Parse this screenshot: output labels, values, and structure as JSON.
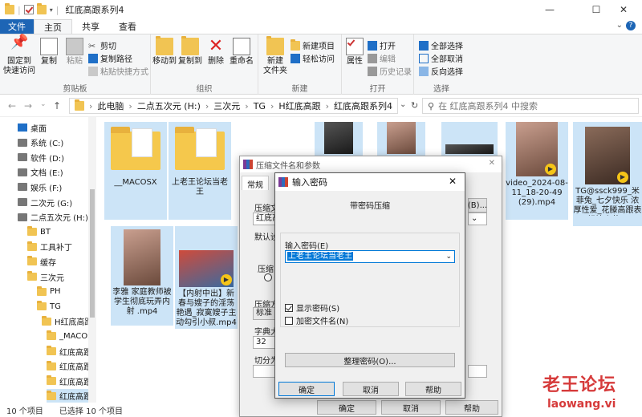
{
  "window": {
    "title": "红底高跟系列4",
    "min": "—",
    "max": "☐",
    "close": "✕"
  },
  "ribbon_tabs": [
    "文件",
    "主页",
    "共享",
    "查看"
  ],
  "ribbon": {
    "clipboard": {
      "pin": "固定到\n快速访问",
      "copy": "复制",
      "paste": "粘贴",
      "cut": "剪切",
      "copy_path": "复制路径",
      "paste_shortcut": "粘贴快捷方式",
      "label": "剪贴板"
    },
    "organize": {
      "move_to": "移动到",
      "copy_to": "复制到",
      "delete": "删除",
      "rename": "重命名",
      "label": "组织"
    },
    "new": {
      "new_folder": "新建\n文件夹",
      "new_item": "新建项目",
      "easy_access": "轻松访问",
      "label": "新建"
    },
    "open": {
      "properties": "属性",
      "open": "打开",
      "edit": "编辑",
      "history": "历史记录",
      "label": "打开"
    },
    "select": {
      "select_all": "全部选择",
      "select_none": "全部取消",
      "invert": "反向选择",
      "label": "选择"
    }
  },
  "address": {
    "breadcrumbs": [
      "此电脑",
      "二点五次元 (H:)",
      "三次元",
      "TG",
      "H红底高跟",
      "红底高跟系列4"
    ],
    "search_placeholder": "在 红底高跟系列4 中搜索"
  },
  "nav": [
    {
      "label": "桌面",
      "icon": "desktop-icon"
    },
    {
      "label": "系统 (C:)",
      "icon": "drive-icon"
    },
    {
      "label": "软件 (D:)",
      "icon": "drive-icon"
    },
    {
      "label": "文档 (E:)",
      "icon": "drive-icon"
    },
    {
      "label": "娱乐 (F:)",
      "icon": "drive-icon"
    },
    {
      "label": "二次元 (G:)",
      "icon": "drive-icon"
    },
    {
      "label": "二点五次元 (H:)",
      "icon": "drive-icon"
    },
    {
      "label": "BT",
      "icon": "folder-icon"
    },
    {
      "label": "工具补丁",
      "icon": "folder-icon"
    },
    {
      "label": "缓存",
      "icon": "folder-icon"
    },
    {
      "label": "三次元",
      "icon": "folder-icon"
    },
    {
      "label": "PH",
      "icon": "folder-icon"
    },
    {
      "label": "TG",
      "icon": "folder-icon"
    },
    {
      "label": "H红底高跟",
      "icon": "folder-icon"
    },
    {
      "label": "_MACOS",
      "icon": "folder-icon"
    },
    {
      "label": "红底高跟系",
      "icon": "folder-icon"
    },
    {
      "label": "红底高跟系",
      "icon": "folder-icon"
    },
    {
      "label": "红底高跟系",
      "icon": "folder-icon"
    },
    {
      "label": "红底高跟系",
      "icon": "folder-icon"
    }
  ],
  "files": [
    {
      "name": "__MACOSX",
      "kind": "folder"
    },
    {
      "name": "上老王论坛当老王",
      "kind": "folder"
    },
    {
      "name": "",
      "kind": "video"
    },
    {
      "name": "",
      "kind": "video"
    },
    {
      "name": "",
      "kind": "video"
    },
    {
      "name": "video_2024-08-11_18-20-49 (29).mp4",
      "kind": "video"
    },
    {
      "name": "TG@ssck999_米菲兔_七夕快乐 浓厚性爱_花滕高跟表姐情人节...",
      "kind": "video"
    },
    {
      "name": "李雅 家庭教师被学生彻底玩弄内射 .mp4",
      "kind": "video"
    },
    {
      "name": "【内射中出】新春与嫂子的淫荡艳遇_寂寞嫂子主动勾引小叔.mp4",
      "kind": "video"
    }
  ],
  "status": {
    "count": "10 个项目",
    "selected": "已选择 10 个项目"
  },
  "archive_dialog": {
    "title": "压缩文件名和参数",
    "tab_general": "常规",
    "label_archive_name": "压缩文",
    "archive_name_value": "红底高",
    "browse": "(B)...",
    "label_default": "默认设",
    "label_format": "压缩",
    "label_method": "压缩方",
    "method_value": "标准",
    "label_dict": "字典大",
    "dict_value": "32",
    "label_split": "切分为",
    "ok": "确定",
    "cancel": "取消",
    "help": "帮助"
  },
  "password_dialog": {
    "title": "输入密码",
    "heading": "带密码压缩",
    "label_password": "输入密码(E)",
    "password_value": "上老王论坛当老王",
    "show_password": "显示密码(S)",
    "encrypt_names": "加密文件名(N)",
    "organize": "整理密码(O)...",
    "ok": "确定",
    "cancel": "取消",
    "help": "帮助"
  },
  "watermark": {
    "line1": "老王论坛",
    "line2": "laowang.vi"
  }
}
